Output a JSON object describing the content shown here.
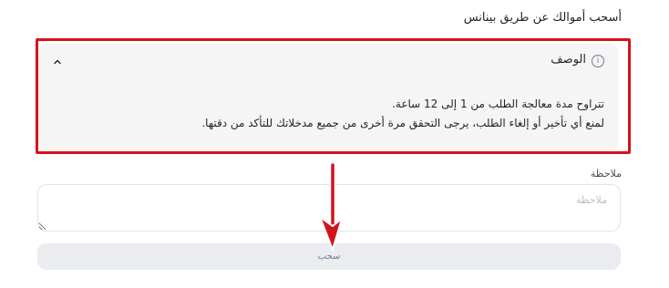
{
  "page": {
    "title": "أسحب أموالك عن طريق بينانس"
  },
  "description": {
    "title": "الوصف",
    "lines": [
      "تتراوح مدة معالجة الطلب من 1 إلى 12 ساعة.",
      "لمنع أي تأخير أو إلغاء الطلب، يرجى التحقق مرة أخرى من جميع مدخلاتك للتأكد من دقتها."
    ]
  },
  "note": {
    "label": "ملاحظة",
    "placeholder": "ملاحظة"
  },
  "withdraw": {
    "label": "سحب"
  },
  "icons": {
    "info": "info-icon",
    "chevron": "chevron-up-icon"
  },
  "colors": {
    "highlight_border": "#d3131a",
    "panel_bg": "#f5f5f5",
    "button_bg": "#eaecef"
  }
}
